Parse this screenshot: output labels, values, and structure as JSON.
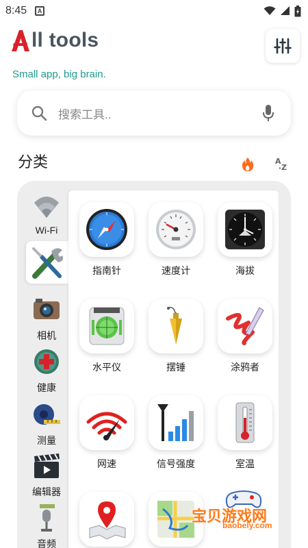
{
  "status": {
    "time": "8:45",
    "notif_letter": "A"
  },
  "header": {
    "title": "ll tools",
    "tagline": "Small app, big brain."
  },
  "search": {
    "placeholder": "搜索工具.."
  },
  "section": {
    "title": "分类"
  },
  "categories": [
    {
      "label": "Wi-Fi"
    },
    {
      "label": ""
    },
    {
      "label": "相机"
    },
    {
      "label": "健康"
    },
    {
      "label": "测量"
    },
    {
      "label": "编辑器"
    },
    {
      "label": "音频"
    }
  ],
  "tools": [
    {
      "label": "指南针",
      "icon": "compass-icon"
    },
    {
      "label": "速度计",
      "icon": "speedometer-icon"
    },
    {
      "label": "海拔",
      "icon": "altimeter-icon"
    },
    {
      "label": "水平仪",
      "icon": "level-icon"
    },
    {
      "label": "摆锤",
      "icon": "plumb-bob-icon"
    },
    {
      "label": "涂鸦者",
      "icon": "doodle-icon"
    },
    {
      "label": "网速",
      "icon": "network-speed-icon"
    },
    {
      "label": "信号强度",
      "icon": "signal-strength-icon"
    },
    {
      "label": "室温",
      "icon": "thermometer-icon"
    },
    {
      "label": "",
      "icon": "map-pin-icon"
    },
    {
      "label": "",
      "icon": "route-map-icon"
    }
  ],
  "watermark": {
    "cn": "宝贝游戏网",
    "en": "baobely.com"
  },
  "colors": {
    "brand_red": "#d8222b",
    "title_gray": "#4a5561",
    "tagline_teal": "#1f9a8a",
    "accent_orange": "#ff6a1a"
  }
}
